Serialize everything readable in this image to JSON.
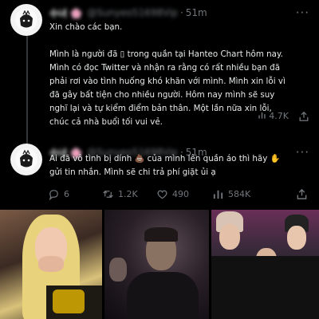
{
  "post1": {
    "display_name": "수녀 🌸",
    "handle": "@Sunyeo51698Vip",
    "separator": "·",
    "time": "51m",
    "lines": [
      "Xin chào các bạn.",
      "",
      "Mình là người đã ▯ trong quần tại Hanteo Chart hôm nay.",
      "Mình có đọc Twitter và nhận ra rằng có rất nhiều bạn đã",
      "phải rơi vào tình huống khó khăn với mình. Mình xin lỗi vì",
      "đã gây bất tiện cho nhiều người. Hôm nay mình sẽ suy",
      "nghĩ lại và tự kiểm điểm bản thân. Một lần nữa xin lỗi,",
      "chúc cả nhà buổi tối vui vẻ."
    ],
    "views": "4.7K"
  },
  "post2": {
    "display_name": "수녀 🌸",
    "handle": "@Sunyeo51698Vip",
    "separator": "·",
    "time": "51m",
    "lines": [
      "Ai đã vô tình bị dính 💩 của mình lên quần áo thì hãy ✋",
      "gửi tin nhắn. Mình sẽ chi trả phí giặt ủi ạ"
    ],
    "replies": "6",
    "reposts": "1.2K",
    "likes": "490",
    "views": "584K"
  },
  "icons": [
    "more-icon",
    "reply-icon",
    "repost-icon",
    "like-icon",
    "views-icon",
    "share-icon"
  ]
}
